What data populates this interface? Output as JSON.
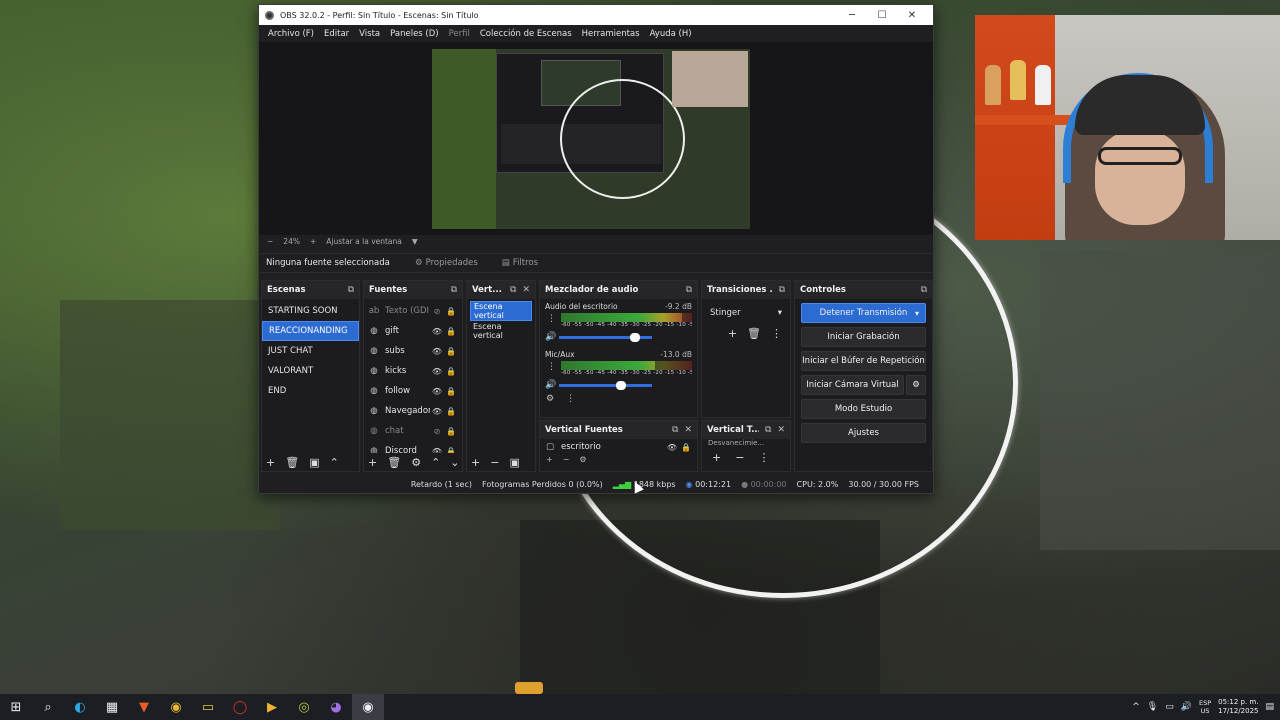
{
  "window": {
    "title": "OBS 32.0.2 - Perfil: Sin Título - Escenas: Sin Título",
    "minimize": "─",
    "maximize": "☐",
    "close": "✕"
  },
  "menu": [
    "Archivo (F)",
    "Editar",
    "Vista",
    "Paneles (D)",
    "Perfil",
    "Colección de Escenas",
    "Herramientas",
    "Ayuda (H)"
  ],
  "preview": {
    "zoom": "24%",
    "fit_label": "Ajustar a la ventana"
  },
  "source_toolbar": {
    "no_source": "Ninguna fuente seleccionada",
    "properties": "Propiedades",
    "filters": "Filtros"
  },
  "scenes": {
    "title": "Escenas",
    "items": [
      "STARTING SOON",
      "REACCIONANDING",
      "JUST CHAT",
      "VALORANT",
      "END"
    ],
    "selected": "REACCIONANDING"
  },
  "sources": {
    "title": "Fuentes",
    "items": [
      {
        "label": "Texto (GDI+)",
        "icon": "text-icon",
        "glyph": "ab",
        "visible": false
      },
      {
        "label": "gift",
        "icon": "browser-icon",
        "glyph": "◍",
        "visible": true
      },
      {
        "label": "subs",
        "icon": "browser-icon",
        "glyph": "◍",
        "visible": true
      },
      {
        "label": "kicks",
        "icon": "browser-icon",
        "glyph": "◍",
        "visible": true
      },
      {
        "label": "follow",
        "icon": "browser-icon",
        "glyph": "◍",
        "visible": true
      },
      {
        "label": "Navegador",
        "icon": "browser-icon",
        "glyph": "◍",
        "visible": true
      },
      {
        "label": "chat",
        "icon": "browser-icon",
        "glyph": "◍",
        "visible": false
      },
      {
        "label": "Discord",
        "icon": "browser-icon",
        "glyph": "◍",
        "visible": true
      }
    ]
  },
  "vertical": {
    "title": "Vert...",
    "items": [
      "Escena vertical",
      "Escena vertical"
    ]
  },
  "mixer": {
    "title": "Mezclador de audio",
    "channels": [
      {
        "name": "Audio del escritorio",
        "db": "-9.2 dB",
        "level": 0.92,
        "volume": 0.82
      },
      {
        "name": "Mic/Aux",
        "db": "-13.0 dB",
        "level": 0.72,
        "volume": 0.67
      }
    ],
    "scale": "-60 -55 -50 -45 -40 -35 -30 -25 -20 -15 -10 -5 0"
  },
  "transitions": {
    "title": "Transiciones ...",
    "selected": "Stinger"
  },
  "controls": {
    "title": "Controles",
    "stop_stream": "Detener Transmisión",
    "start_record": "Iniciar Grabación",
    "replay_buffer": "Iniciar el Búfer de Repetición",
    "virtual_cam": "Iniciar Cámara Virtual",
    "studio_mode": "Modo Estudio",
    "settings": "Ajustes"
  },
  "vertical_sources": {
    "title": "Vertical Fuentes",
    "item": "escritorio"
  },
  "vertical_transitions": {
    "title": "Vertical T...",
    "selected": "Desvanecimie..."
  },
  "status": {
    "delay": "Retardo (1 sec)",
    "dropped": "Fotogramas Perdidos 0 (0.0%)",
    "bitrate": "1848 kbps",
    "stream_time": "00:12:21",
    "record_time": "00:00:00",
    "cpu": "CPU: 2.0%",
    "fps": "30.00 / 30.00 FPS"
  },
  "taskbar": {
    "lang_top": "ESP",
    "lang_bottom": "US",
    "time": "05:12 p. m.",
    "date": "17/12/2025"
  },
  "colors": {
    "accent": "#2c6bd1",
    "panel": "#1c1c1f",
    "window": "#1f1f22"
  }
}
